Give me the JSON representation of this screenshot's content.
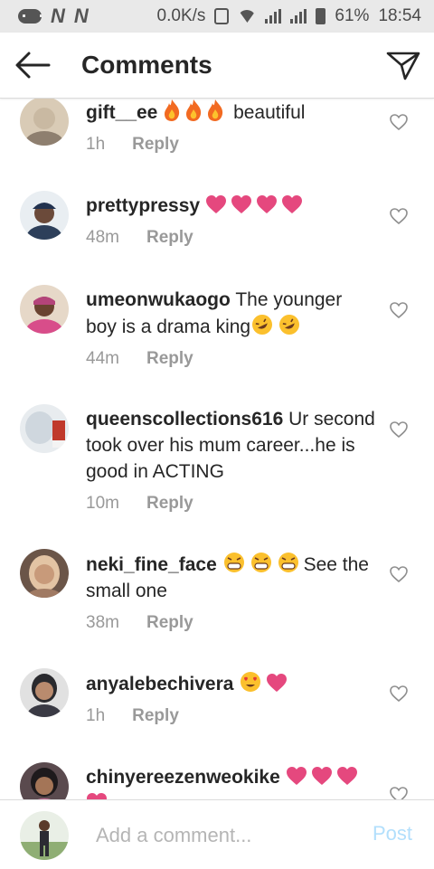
{
  "status_bar": {
    "speed": "0.0K/s",
    "battery": "61%",
    "time": "18:54",
    "carrier_icons": [
      "N",
      "N"
    ]
  },
  "header": {
    "title": "Comments",
    "back_icon": "arrow-left-icon",
    "send_icon": "paper-plane-icon"
  },
  "comments": [
    {
      "username": "gift__ee",
      "emojis": [
        "fire",
        "fire",
        "fire"
      ],
      "text": "beautiful",
      "time": "1h",
      "reply": "Reply",
      "avatar_color": "#c9b9a2"
    },
    {
      "username": "prettypressy",
      "emojis": [
        "heart",
        "heart",
        "heart",
        "heart"
      ],
      "text": "",
      "time": "48m",
      "reply": "Reply",
      "avatar_color": "#2d3f5a"
    },
    {
      "username": "umeonwukaogo",
      "text_before": "The younger boy is a drama king",
      "emojis": [
        "rofl",
        "rofl"
      ],
      "time": "44m",
      "reply": "Reply",
      "avatar_color": "#b4447a"
    },
    {
      "username": "queenscollections616",
      "text": "Ur second took over his mum career...he is good in ACTING",
      "time": "10m",
      "reply": "Reply",
      "avatar_color": "#d8dde3"
    },
    {
      "username": "neki_fine_face",
      "emojis": [
        "grin",
        "grin",
        "grin"
      ],
      "text": "See the small one",
      "time": "38m",
      "reply": "Reply",
      "avatar_color": "#c89a7a"
    },
    {
      "username": "anyalebechivera",
      "emojis": [
        "heart-eyes",
        "heart"
      ],
      "text": "",
      "time": "1h",
      "reply": "Reply",
      "avatar_color": "#3a3a44"
    },
    {
      "username": "chinyereezenweokike",
      "emojis": [
        "heart",
        "heart",
        "heart",
        "heart"
      ],
      "text": "",
      "time": "",
      "reply": "",
      "avatar_color": "#4a3a3e"
    }
  ],
  "composer": {
    "placeholder": "Add a comment...",
    "post_label": "Post"
  },
  "colors": {
    "heart": "#e5487e",
    "meta": "#999999",
    "post_disabled": "#b2dffc",
    "fire": "#f26a21"
  }
}
